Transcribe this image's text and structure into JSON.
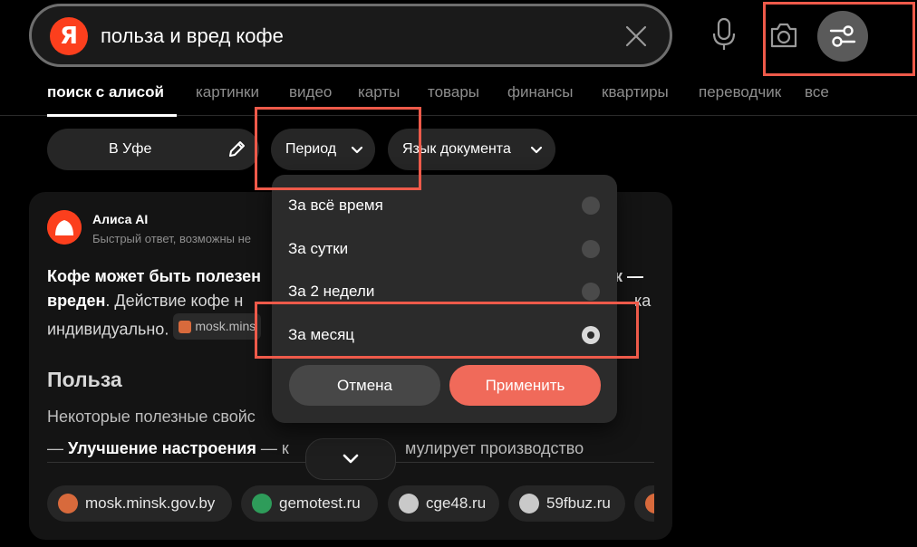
{
  "search": {
    "logo_letter": "Я",
    "query": "польза и вред кофе"
  },
  "tabs": [
    {
      "label": "поиск с алисой",
      "active": true
    },
    {
      "label": "картинки"
    },
    {
      "label": "видео"
    },
    {
      "label": "карты"
    },
    {
      "label": "товары"
    },
    {
      "label": "финансы"
    },
    {
      "label": "квартиры"
    },
    {
      "label": "переводчик"
    },
    {
      "label": "все"
    }
  ],
  "filters": {
    "region": "В Уфе",
    "period": "Период",
    "language": "Язык документа"
  },
  "period_menu": {
    "options": [
      {
        "label": "За всё время",
        "selected": false
      },
      {
        "label": "За сутки",
        "selected": false
      },
      {
        "label": "За 2 недели",
        "selected": false
      },
      {
        "label": "За месяц",
        "selected": true
      }
    ],
    "cancel_label": "Отмена",
    "apply_label": "Применить"
  },
  "answer": {
    "title": "Алиса AI",
    "subtitle": "Быстрый ответ, возможны не",
    "line1_bold": "Кофе может быть полезен",
    "line1_tail": "к —",
    "line2_bold": "вреден",
    "line2_rest": ". Действие кофе н",
    "line2_tail": "ка",
    "line3": "индивидуально.",
    "inline_source": "mosk.mins",
    "section_title": "Польза",
    "section_text": "Некоторые полезные свойс",
    "bullet_dash": "— ",
    "bullet_bold": "Улучшение настроения",
    "bullet_mid": " — к",
    "bullet_tail": "мулирует производство"
  },
  "sources": [
    {
      "label": "mosk.minsk.gov.by",
      "color": "#d86a3c"
    },
    {
      "label": "gemotest.ru",
      "color": "#2e9c5a"
    },
    {
      "label": "cge48.ru",
      "color": "#c9c9c9"
    },
    {
      "label": "59fbuz.ru",
      "color": "#c9c9c9"
    }
  ],
  "colors": {
    "accent": "#fc3f1d",
    "apply": "#f06a5a",
    "highlight": "#ee5a4a"
  }
}
